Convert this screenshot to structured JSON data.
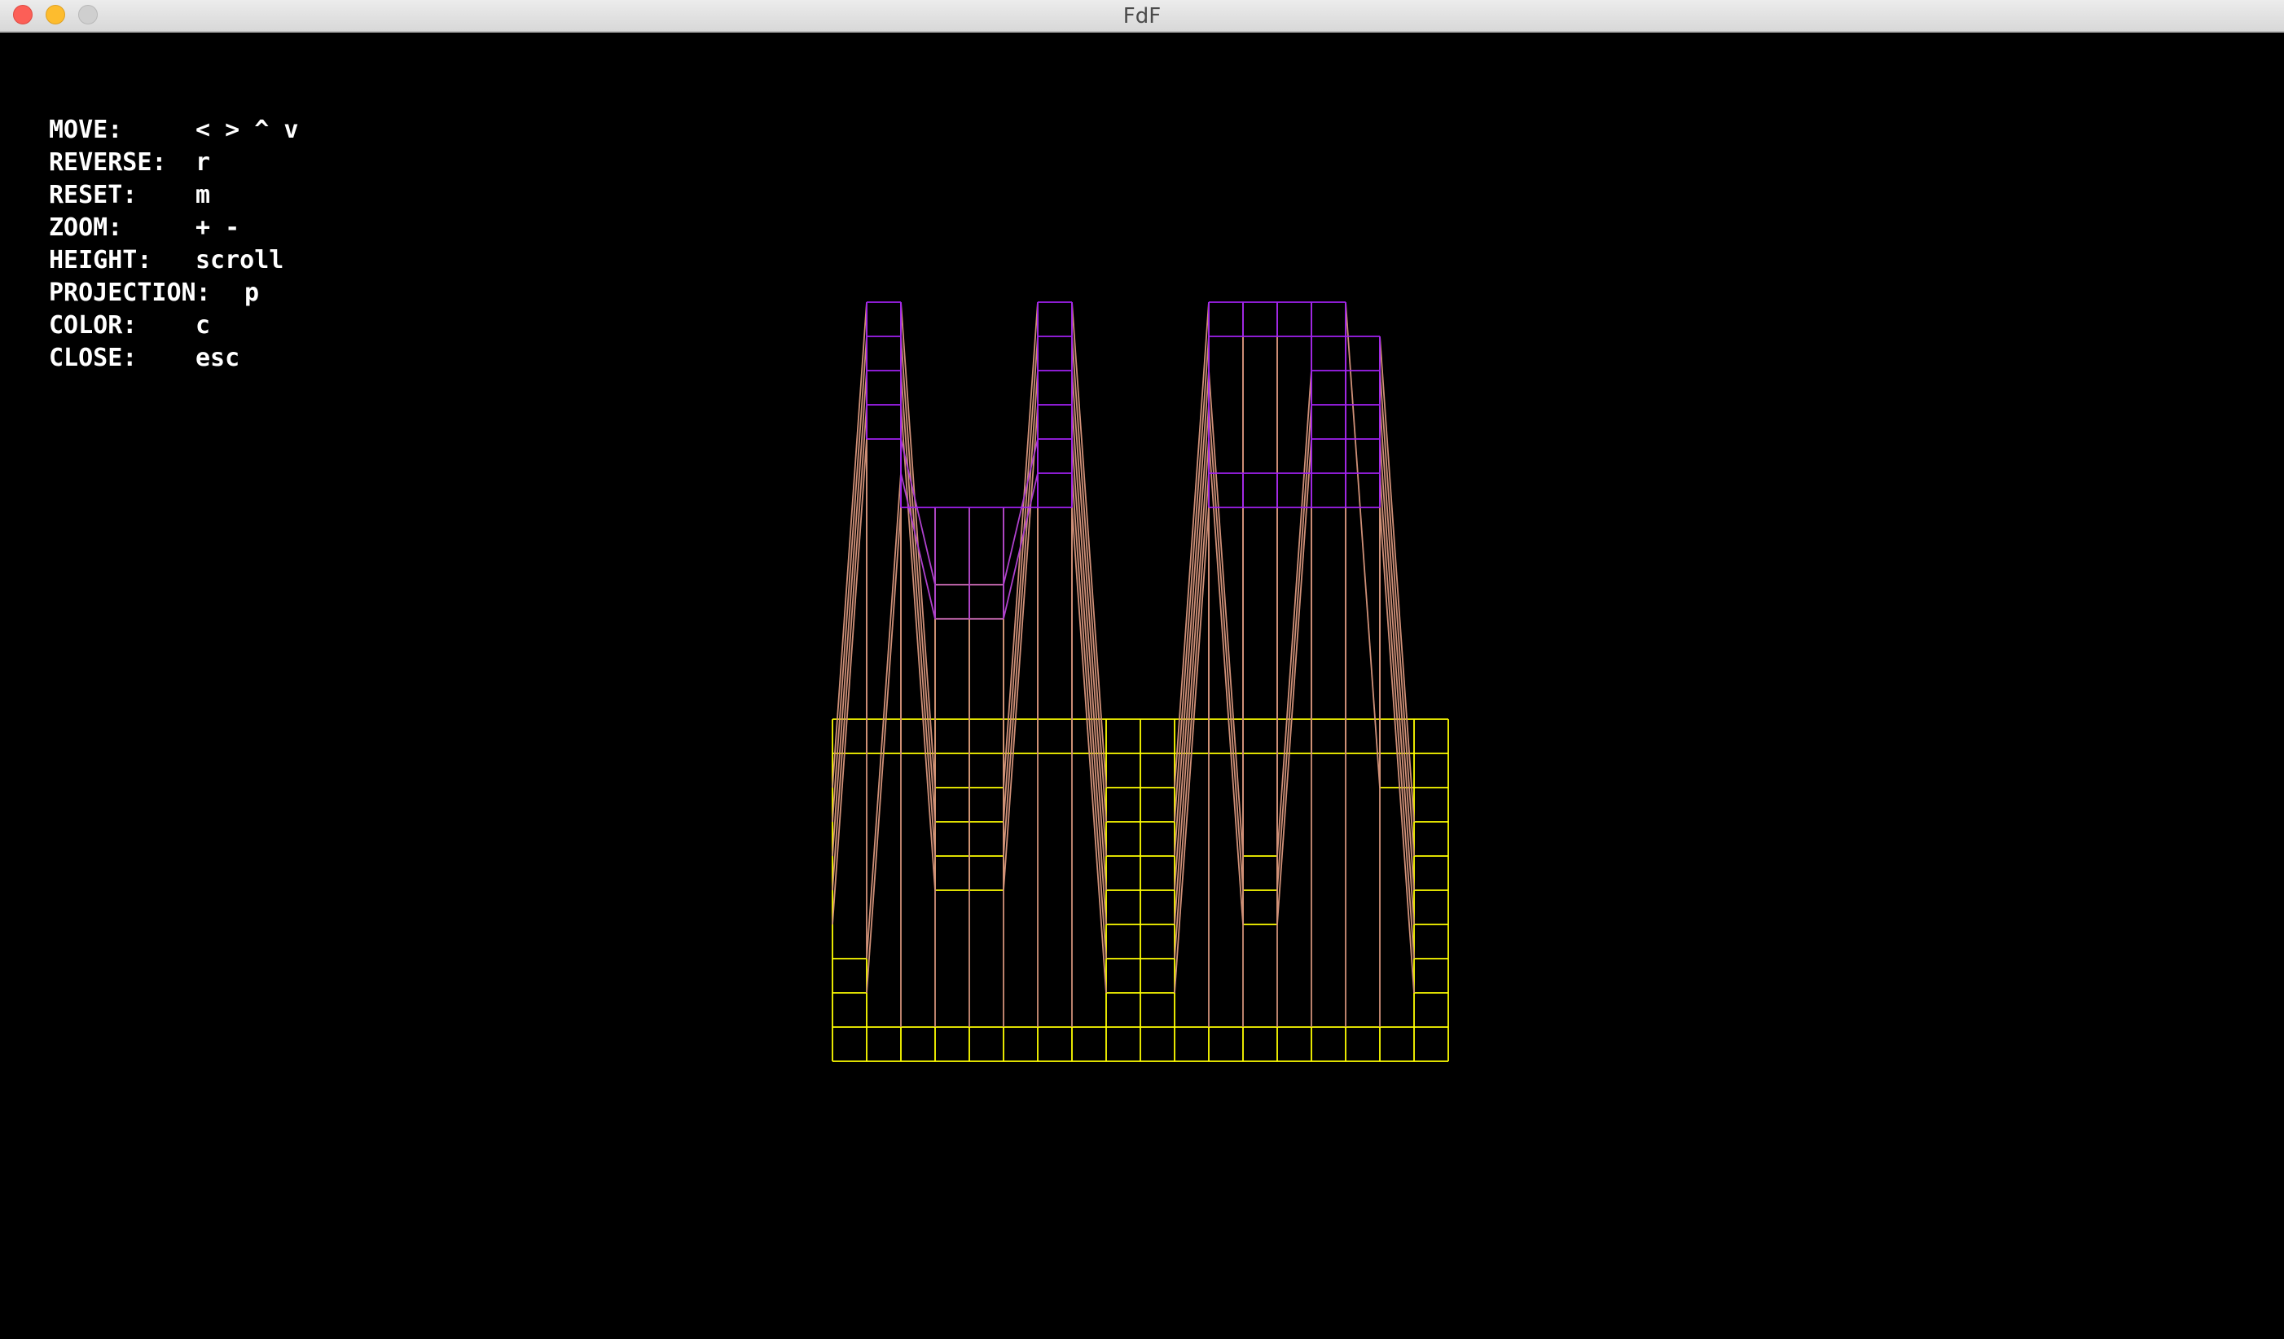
{
  "window": {
    "title": "FdF"
  },
  "controls": [
    {
      "key": "MOVE:",
      "value": "< > ^ v"
    },
    {
      "key": "REVERSE:",
      "value": "r"
    },
    {
      "key": "RESET:",
      "value": "m"
    },
    {
      "key": "ZOOM:",
      "value": "+ -"
    },
    {
      "key": "HEIGHT:",
      "value": "scroll"
    },
    {
      "key": "PROJECTION:",
      "value": "p"
    },
    {
      "key": "COLOR:",
      "value": "c"
    },
    {
      "key": "CLOSE:",
      "value": "esc"
    }
  ],
  "render": {
    "projection": "parallel",
    "base_color": "#ffff00",
    "peak_color": "#a020f0",
    "background_color": "#000000",
    "map_columns": 19,
    "map_rows": 11,
    "heightmap": [
      [
        0,
        0,
        0,
        0,
        0,
        0,
        0,
        0,
        0,
        0,
        0,
        0,
        0,
        0,
        0,
        0,
        0,
        0,
        0
      ],
      [
        0,
        0,
        0,
        0,
        0,
        0,
        0,
        0,
        0,
        0,
        0,
        0,
        0,
        0,
        0,
        0,
        0,
        0,
        0
      ],
      [
        0,
        10,
        10,
        0,
        0,
        0,
        10,
        10,
        0,
        0,
        0,
        10,
        10,
        10,
        10,
        10,
        0,
        0,
        0
      ],
      [
        0,
        10,
        10,
        0,
        0,
        0,
        10,
        10,
        0,
        0,
        0,
        10,
        10,
        10,
        10,
        10,
        10,
        0,
        0
      ],
      [
        0,
        10,
        10,
        0,
        0,
        0,
        10,
        10,
        0,
        0,
        0,
        10,
        0,
        0,
        10,
        10,
        10,
        0,
        0
      ],
      [
        0,
        10,
        10,
        0,
        0,
        0,
        10,
        10,
        0,
        0,
        0,
        10,
        0,
        0,
        10,
        10,
        10,
        0,
        0
      ],
      [
        0,
        10,
        10,
        7,
        7,
        7,
        10,
        10,
        0,
        0,
        0,
        10,
        0,
        0,
        10,
        10,
        10,
        0,
        0
      ],
      [
        0,
        0,
        10,
        7,
        7,
        7,
        10,
        10,
        0,
        0,
        0,
        10,
        10,
        10,
        10,
        10,
        10,
        0,
        0
      ],
      [
        0,
        0,
        10,
        10,
        10,
        10,
        10,
        10,
        0,
        0,
        0,
        10,
        10,
        10,
        10,
        10,
        10,
        0,
        0
      ],
      [
        0,
        0,
        0,
        0,
        0,
        0,
        0,
        0,
        0,
        0,
        0,
        0,
        0,
        0,
        0,
        0,
        0,
        0,
        0
      ],
      [
        0,
        0,
        0,
        0,
        0,
        0,
        0,
        0,
        0,
        0,
        0,
        0,
        0,
        0,
        0,
        0,
        0,
        0,
        0
      ]
    ]
  }
}
